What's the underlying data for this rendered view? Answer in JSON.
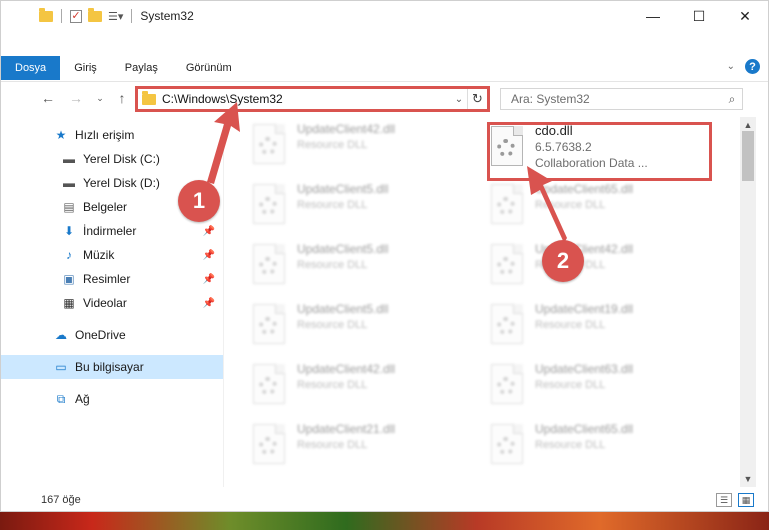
{
  "window": {
    "title": "System32"
  },
  "colors": {
    "accent": "#1979ca",
    "annotation": "#d9534f",
    "selection": "#cce8ff"
  },
  "ribbon": {
    "tabs": [
      "Dosya",
      "Giriş",
      "Paylaş",
      "Görünüm"
    ],
    "active_tab": "Dosya"
  },
  "address": {
    "path": "C:\\Windows\\System32"
  },
  "search": {
    "placeholder": "Ara: System32"
  },
  "sidebar": {
    "items": [
      {
        "label": "Hızlı erişim",
        "icon": "star-icon"
      },
      {
        "label": "Yerel Disk (C:)",
        "icon": "drive-icon",
        "pinned": false
      },
      {
        "label": "Yerel Disk (D:)",
        "icon": "drive-icon",
        "pinned": false
      },
      {
        "label": "Belgeler",
        "icon": "document-icon",
        "pinned": false
      },
      {
        "label": "İndirmeler",
        "icon": "download-icon",
        "pinned": true
      },
      {
        "label": "Müzik",
        "icon": "music-icon",
        "pinned": true
      },
      {
        "label": "Resimler",
        "icon": "pictures-icon",
        "pinned": true
      },
      {
        "label": "Videolar",
        "icon": "video-icon",
        "pinned": true
      },
      {
        "label": "OneDrive",
        "icon": "cloud-icon"
      },
      {
        "label": "Bu bilgisayar",
        "icon": "computer-icon",
        "selected": true
      },
      {
        "label": "Ağ",
        "icon": "network-icon"
      }
    ]
  },
  "files": {
    "highlighted": {
      "name": "cdo.dll",
      "version": "6.5.7638.2",
      "description": "Collaboration Data ..."
    },
    "left_column": [
      {
        "name": "UpdateClient42.dll",
        "sub": "Resource DLL"
      },
      {
        "name": "UpdateClient5.dll",
        "sub": "Resource DLL"
      },
      {
        "name": "UpdateClient5.dll",
        "sub": "Resource DLL"
      },
      {
        "name": "UpdateClient5.dll",
        "sub": "Resource DLL"
      },
      {
        "name": "UpdateClient42.dll",
        "sub": "Resource DLL"
      },
      {
        "name": "UpdateClient21.dll",
        "sub": "Resource DLL"
      }
    ],
    "right_column": [
      {
        "name": "UpdateClient65.dll",
        "sub": "Resource DLL"
      },
      {
        "name": "UpdateClient42.dll",
        "sub": "Resource DLL"
      },
      {
        "name": "UpdateClient19.dll",
        "sub": "Resource DLL"
      },
      {
        "name": "UpdateClient63.dll",
        "sub": "Resource DLL"
      },
      {
        "name": "UpdateClient65.dll",
        "sub": "Resource DLL"
      }
    ]
  },
  "status": {
    "item_count": "167 öğe"
  },
  "annotations": {
    "step1": "1",
    "step2": "2"
  }
}
